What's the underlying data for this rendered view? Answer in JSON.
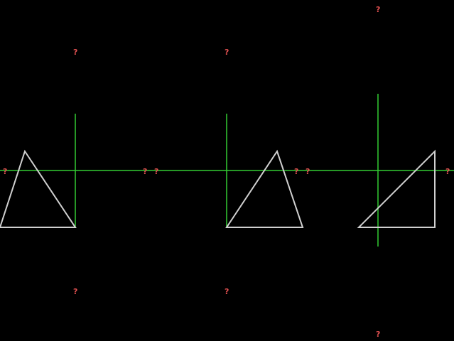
{
  "colors": {
    "background": "#000000",
    "axis": "#33cc33",
    "triangle": "#d0d0d0",
    "marker": "#e05050"
  },
  "marker_glyph": "?",
  "panels": [
    {
      "name": "panel-left",
      "triangle_shape": "acute apex left of vertical axis",
      "marker_count": 4
    },
    {
      "name": "panel-middle",
      "triangle_shape": "acute apex right of vertical axis",
      "marker_count": 4
    },
    {
      "name": "panel-right",
      "triangle_shape": "right triangle crossing vertical axis",
      "marker_count": 4
    }
  ]
}
